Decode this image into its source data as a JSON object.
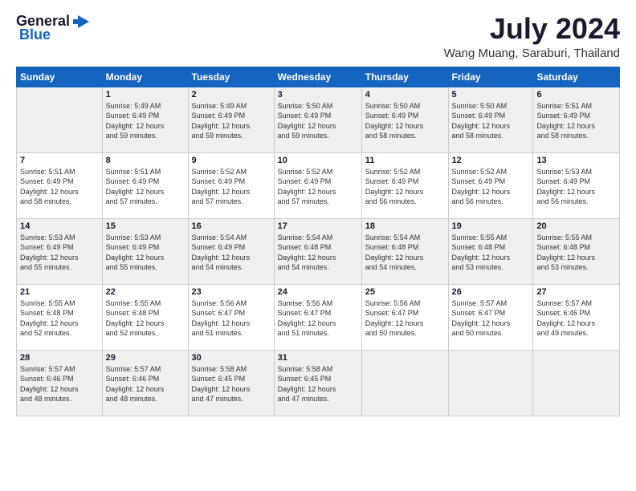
{
  "logo": {
    "general": "General",
    "blue": "Blue"
  },
  "header": {
    "month_year": "July 2024",
    "location": "Wang Muang, Saraburi, Thailand"
  },
  "weekdays": [
    "Sunday",
    "Monday",
    "Tuesday",
    "Wednesday",
    "Thursday",
    "Friday",
    "Saturday"
  ],
  "weeks": [
    [
      {
        "day": "",
        "info": ""
      },
      {
        "day": "1",
        "info": "Sunrise: 5:49 AM\nSunset: 6:49 PM\nDaylight: 12 hours\nand 59 minutes."
      },
      {
        "day": "2",
        "info": "Sunrise: 5:49 AM\nSunset: 6:49 PM\nDaylight: 12 hours\nand 59 minutes."
      },
      {
        "day": "3",
        "info": "Sunrise: 5:50 AM\nSunset: 6:49 PM\nDaylight: 12 hours\nand 59 minutes."
      },
      {
        "day": "4",
        "info": "Sunrise: 5:50 AM\nSunset: 6:49 PM\nDaylight: 12 hours\nand 58 minutes."
      },
      {
        "day": "5",
        "info": "Sunrise: 5:50 AM\nSunset: 6:49 PM\nDaylight: 12 hours\nand 58 minutes."
      },
      {
        "day": "6",
        "info": "Sunrise: 5:51 AM\nSunset: 6:49 PM\nDaylight: 12 hours\nand 58 minutes."
      }
    ],
    [
      {
        "day": "7",
        "info": "Sunrise: 5:51 AM\nSunset: 6:49 PM\nDaylight: 12 hours\nand 58 minutes."
      },
      {
        "day": "8",
        "info": "Sunrise: 5:51 AM\nSunset: 6:49 PM\nDaylight: 12 hours\nand 57 minutes."
      },
      {
        "day": "9",
        "info": "Sunrise: 5:52 AM\nSunset: 6:49 PM\nDaylight: 12 hours\nand 57 minutes."
      },
      {
        "day": "10",
        "info": "Sunrise: 5:52 AM\nSunset: 6:49 PM\nDaylight: 12 hours\nand 57 minutes."
      },
      {
        "day": "11",
        "info": "Sunrise: 5:52 AM\nSunset: 6:49 PM\nDaylight: 12 hours\nand 56 minutes."
      },
      {
        "day": "12",
        "info": "Sunrise: 5:52 AM\nSunset: 6:49 PM\nDaylight: 12 hours\nand 56 minutes."
      },
      {
        "day": "13",
        "info": "Sunrise: 5:53 AM\nSunset: 6:49 PM\nDaylight: 12 hours\nand 56 minutes."
      }
    ],
    [
      {
        "day": "14",
        "info": "Sunrise: 5:53 AM\nSunset: 6:49 PM\nDaylight: 12 hours\nand 55 minutes."
      },
      {
        "day": "15",
        "info": "Sunrise: 5:53 AM\nSunset: 6:49 PM\nDaylight: 12 hours\nand 55 minutes."
      },
      {
        "day": "16",
        "info": "Sunrise: 5:54 AM\nSunset: 6:49 PM\nDaylight: 12 hours\nand 54 minutes."
      },
      {
        "day": "17",
        "info": "Sunrise: 5:54 AM\nSunset: 6:48 PM\nDaylight: 12 hours\nand 54 minutes."
      },
      {
        "day": "18",
        "info": "Sunrise: 5:54 AM\nSunset: 6:48 PM\nDaylight: 12 hours\nand 54 minutes."
      },
      {
        "day": "19",
        "info": "Sunrise: 5:55 AM\nSunset: 6:48 PM\nDaylight: 12 hours\nand 53 minutes."
      },
      {
        "day": "20",
        "info": "Sunrise: 5:55 AM\nSunset: 6:48 PM\nDaylight: 12 hours\nand 53 minutes."
      }
    ],
    [
      {
        "day": "21",
        "info": "Sunrise: 5:55 AM\nSunset: 6:48 PM\nDaylight: 12 hours\nand 52 minutes."
      },
      {
        "day": "22",
        "info": "Sunrise: 5:55 AM\nSunset: 6:48 PM\nDaylight: 12 hours\nand 52 minutes."
      },
      {
        "day": "23",
        "info": "Sunrise: 5:56 AM\nSunset: 6:47 PM\nDaylight: 12 hours\nand 51 minutes."
      },
      {
        "day": "24",
        "info": "Sunrise: 5:56 AM\nSunset: 6:47 PM\nDaylight: 12 hours\nand 51 minutes."
      },
      {
        "day": "25",
        "info": "Sunrise: 5:56 AM\nSunset: 6:47 PM\nDaylight: 12 hours\nand 50 minutes."
      },
      {
        "day": "26",
        "info": "Sunrise: 5:57 AM\nSunset: 6:47 PM\nDaylight: 12 hours\nand 50 minutes."
      },
      {
        "day": "27",
        "info": "Sunrise: 5:57 AM\nSunset: 6:46 PM\nDaylight: 12 hours\nand 49 minutes."
      }
    ],
    [
      {
        "day": "28",
        "info": "Sunrise: 5:57 AM\nSunset: 6:46 PM\nDaylight: 12 hours\nand 48 minutes."
      },
      {
        "day": "29",
        "info": "Sunrise: 5:57 AM\nSunset: 6:46 PM\nDaylight: 12 hours\nand 48 minutes."
      },
      {
        "day": "30",
        "info": "Sunrise: 5:58 AM\nSunset: 6:45 PM\nDaylight: 12 hours\nand 47 minutes."
      },
      {
        "day": "31",
        "info": "Sunrise: 5:58 AM\nSunset: 6:45 PM\nDaylight: 12 hours\nand 47 minutes."
      },
      {
        "day": "",
        "info": ""
      },
      {
        "day": "",
        "info": ""
      },
      {
        "day": "",
        "info": ""
      }
    ]
  ]
}
